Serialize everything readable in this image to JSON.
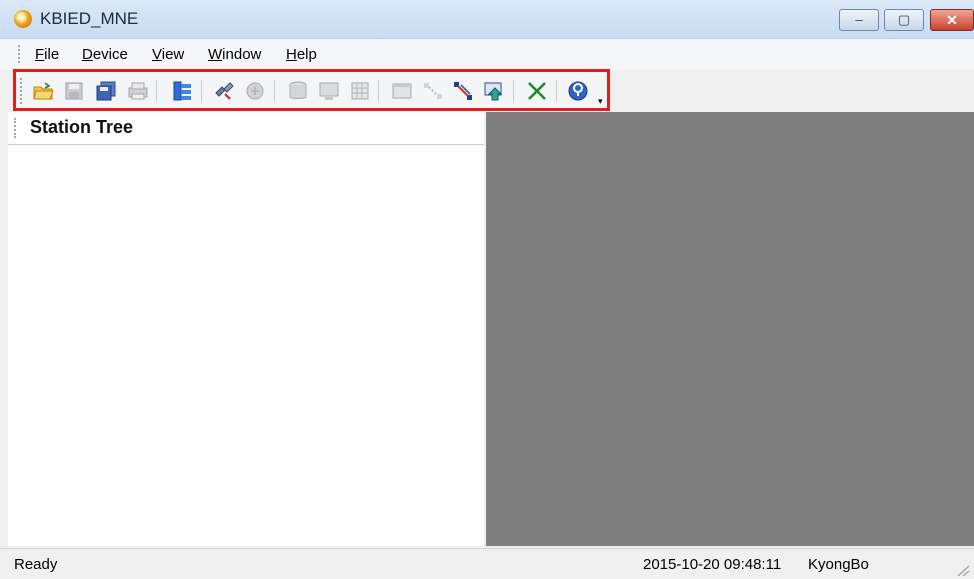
{
  "window": {
    "title": "KBIED_MNE",
    "controls": {
      "minimize_icon": "minimize-icon",
      "maximize_icon": "maximize-icon",
      "close_icon": "close-icon"
    }
  },
  "menu": [
    {
      "accel": "F",
      "rest": "ile"
    },
    {
      "accel": "D",
      "rest": "evice"
    },
    {
      "accel": "V",
      "rest": "iew"
    },
    {
      "accel": "W",
      "rest": "indow"
    },
    {
      "accel": "H",
      "rest": "elp"
    }
  ],
  "toolbar": {
    "highlight_color": "#e0201c",
    "icons": [
      "open-folder-icon",
      "save-icon",
      "save-all-icon",
      "print-icon",
      "station-list-icon",
      "connect-icon",
      "disconnect-icon",
      "database-icon",
      "monitor-icon",
      "grid-icon",
      "window-icon",
      "link-icon",
      "link-edit-icon",
      "upload-icon",
      "delete-icon",
      "help-icon"
    ]
  },
  "station_tree": {
    "title": "Station Tree"
  },
  "status": {
    "text": "Ready",
    "datetime": "2015-10-20 09:48:11",
    "user": "KyongBo"
  },
  "colors": {
    "mdi_background": "#7f7f7f",
    "title_bar": "#c9dcf2"
  }
}
